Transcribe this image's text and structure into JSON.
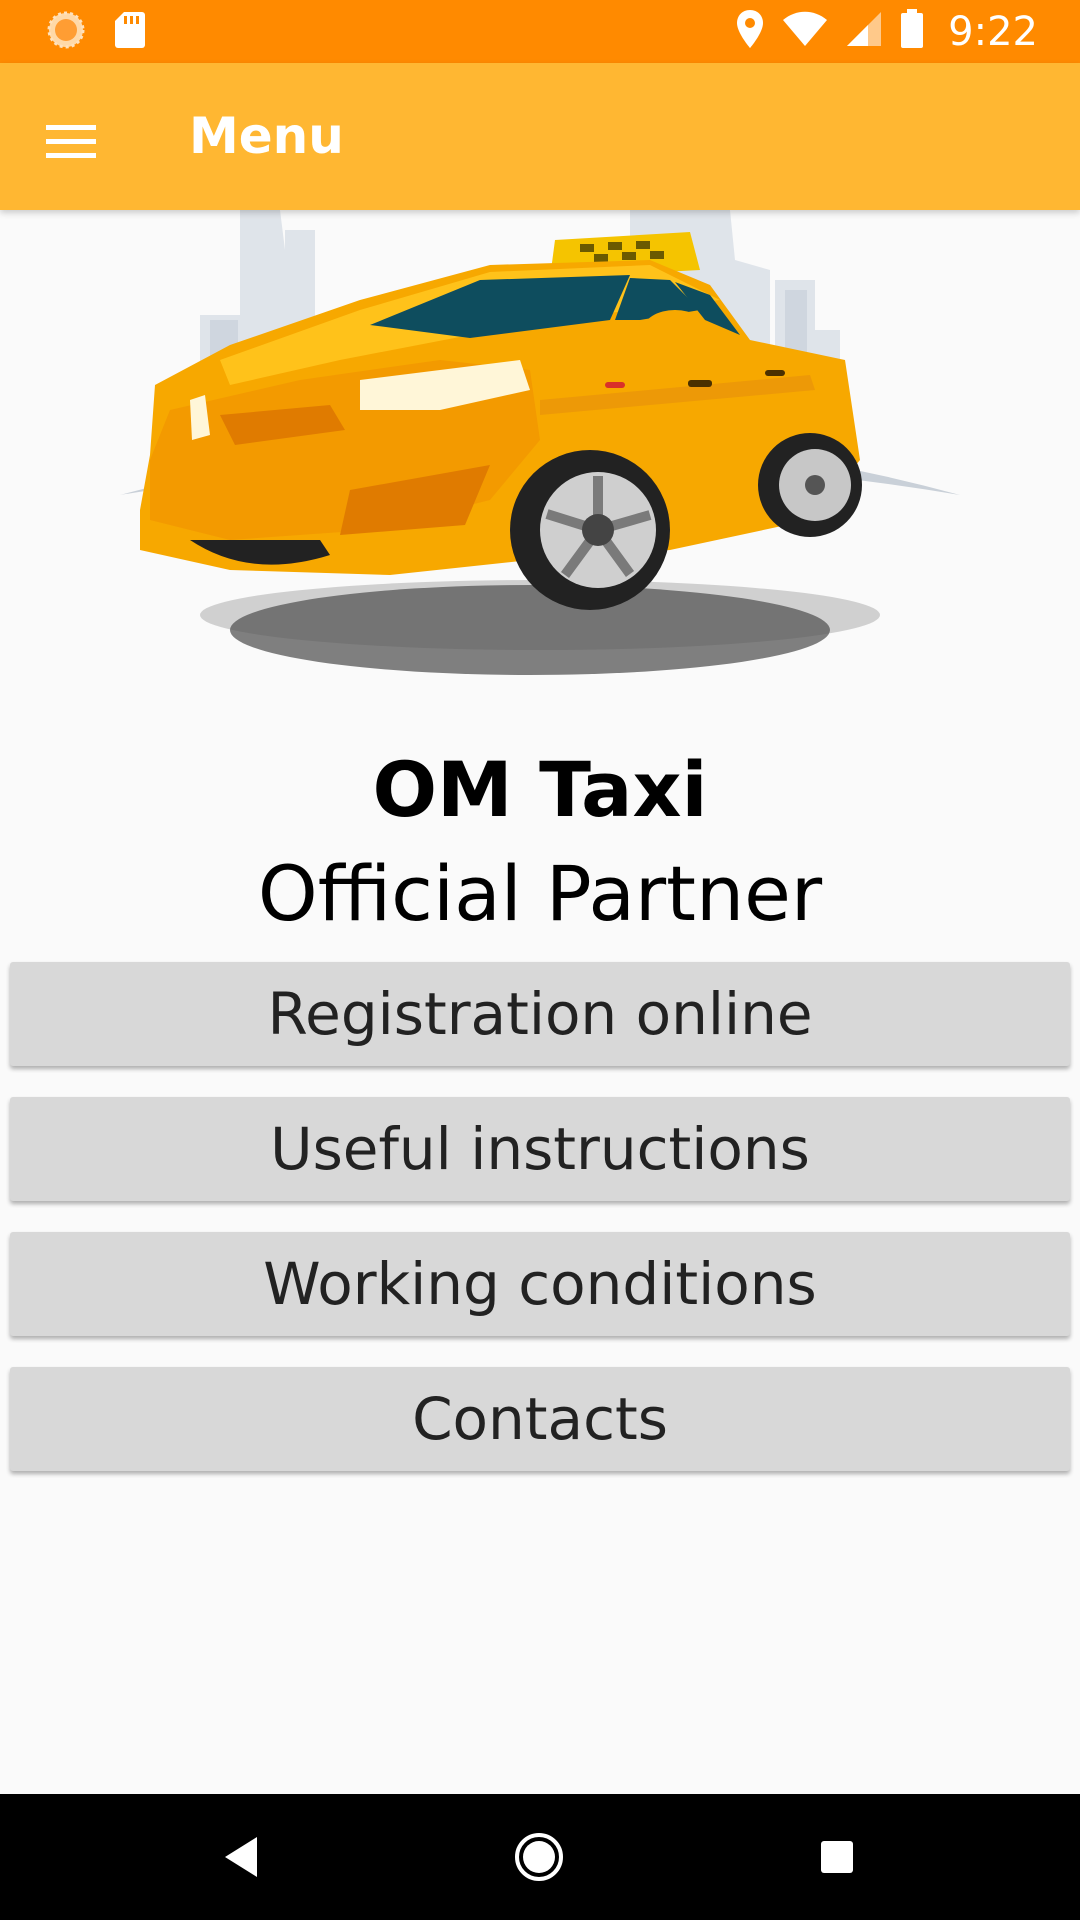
{
  "status_bar": {
    "time": "9:22",
    "left_icons": [
      "circle-notification-icon",
      "sd-card-icon"
    ],
    "right_icons": [
      "location-pin-icon",
      "wifi-icon",
      "cell-signal-icon",
      "battery-icon"
    ],
    "background": "#ff8a00"
  },
  "app_bar": {
    "title": "Menu",
    "menu_icon": "hamburger-menu-icon",
    "background": "#ffb732"
  },
  "hero": {
    "image": "taxi-car-illustration"
  },
  "heading": {
    "brand": "OM Taxi",
    "subtitle": "Official Partner"
  },
  "menu": {
    "items": [
      {
        "label": "Registration online"
      },
      {
        "label": "Useful instructions"
      },
      {
        "label": "Working conditions"
      },
      {
        "label": "Contacts"
      }
    ]
  },
  "nav_bar": {
    "icons": [
      "back-icon",
      "home-icon",
      "recents-icon"
    ]
  }
}
